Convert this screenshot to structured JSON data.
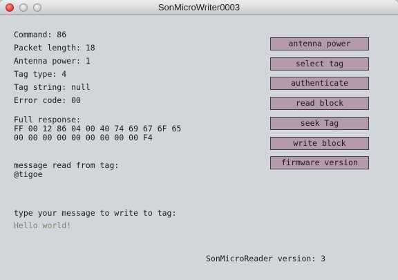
{
  "window": {
    "title": "SonMicroWriter0003"
  },
  "info": {
    "command": "Command: 86",
    "packet_length": "Packet length: 18",
    "antenna_power": "Antenna power: 1",
    "tag_type": "Tag type: 4",
    "tag_string": "Tag string: null",
    "error_code": "Error code: 00",
    "full_response_label": "Full response:",
    "full_response_line1": "FF 00 12 86 04 00 40 74 69 67 6F 65",
    "full_response_line2": "00 00 00 00 00 00 00 00 00 F4",
    "message_read_label": "message read from tag:",
    "message_read_value": "@tigoe",
    "write_prompt": "type your message to write to tag:",
    "write_value": "Hello world!",
    "version": "SonMicroReader version: 3"
  },
  "buttons": [
    "antenna power",
    "select tag",
    "authenticate",
    "read block",
    "seek Tag",
    "write block",
    "firmware version"
  ],
  "colors": {
    "button_fill": "#b39aac",
    "background": "#d2d5d9",
    "input_text": "#7a8872"
  }
}
